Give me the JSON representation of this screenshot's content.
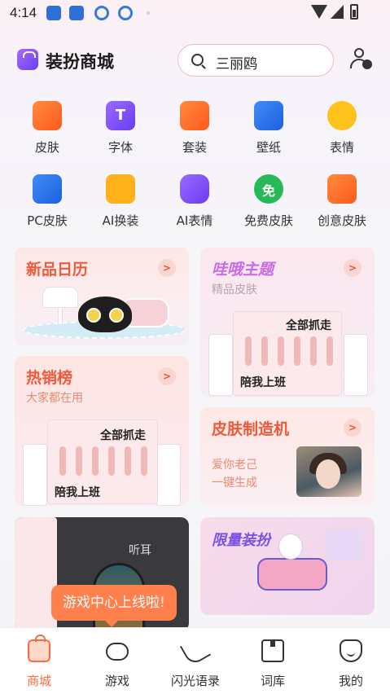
{
  "status_bar": {
    "time": "4:14"
  },
  "header": {
    "title": "装扮商城",
    "search_placeholder": "三丽鸥"
  },
  "categories": [
    {
      "label": "皮肤",
      "icon": "tshirt-icon"
    },
    {
      "label": "字体",
      "icon": "font-icon"
    },
    {
      "label": "套装",
      "icon": "bundle-icon"
    },
    {
      "label": "壁纸",
      "icon": "wallpaper-icon"
    },
    {
      "label": "表情",
      "icon": "emoji-icon"
    },
    {
      "label": "PC皮肤",
      "icon": "monitor-icon"
    },
    {
      "label": "AI换装",
      "icon": "ai-dressup-icon"
    },
    {
      "label": "AI表情",
      "icon": "ai-emoji-icon"
    },
    {
      "label": "免费皮肤",
      "icon": "free-icon"
    },
    {
      "label": "创意皮肤",
      "icon": "creative-icon"
    }
  ],
  "category_glyphs": {
    "font": "T",
    "free": "免"
  },
  "cards": {
    "new_calendar": {
      "title": "新品日历"
    },
    "wahe": {
      "title": "哇哦主题",
      "subtitle": "精品皮肤",
      "sticker_top": "全部抓走",
      "sticker_bottom": "陪我上班"
    },
    "hot": {
      "title": "热销榜",
      "subtitle": "大家都在用",
      "sticker_top": "全部抓走",
      "sticker_bottom": "陪我上班"
    },
    "maker": {
      "title": "皮肤制造机",
      "subtitle_line1": "爱你老己",
      "subtitle_line2": "一键生成"
    },
    "listen": {
      "caption": "听耳"
    },
    "limited": {
      "title": "限量装扮"
    }
  },
  "tooltip": {
    "text": "游戏中心上线啦!"
  },
  "bottom_nav": [
    {
      "label": "商城",
      "active": true
    },
    {
      "label": "游戏",
      "active": false
    },
    {
      "label": "闪光语录",
      "active": false
    },
    {
      "label": "词库",
      "active": false
    },
    {
      "label": "我的",
      "active": false
    }
  ],
  "colors": {
    "accent": "#ff6a3d",
    "card_title": "#f0593a",
    "search_border": "#f1b7c6"
  }
}
